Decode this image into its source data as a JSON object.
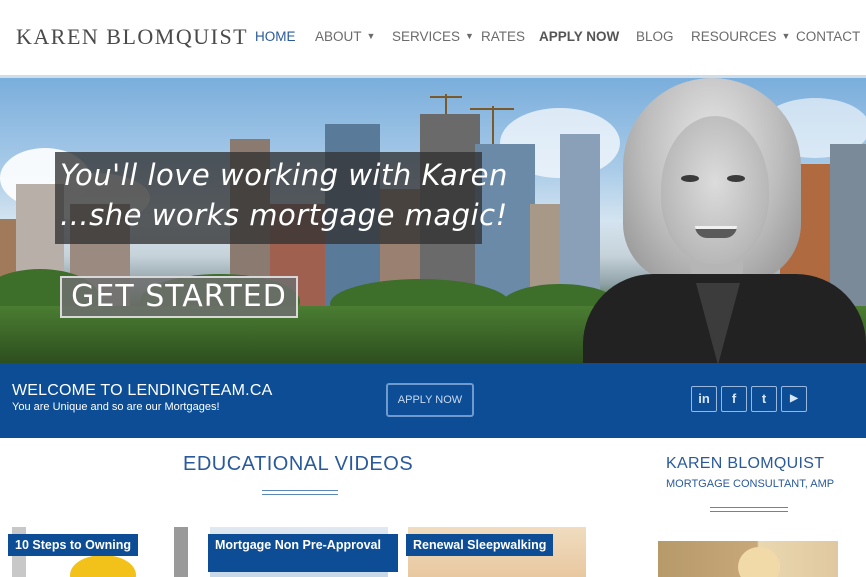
{
  "header": {
    "logo": "KAREN BLOMQUIST",
    "nav": [
      {
        "label": "HOME",
        "active": true,
        "dropdown": false
      },
      {
        "label": "ABOUT",
        "active": false,
        "dropdown": true
      },
      {
        "label": "SERVICES",
        "active": false,
        "dropdown": true
      },
      {
        "label": "RATES",
        "active": false,
        "dropdown": false
      },
      {
        "label": "APPLY NOW",
        "active": false,
        "dropdown": false,
        "bold": true
      },
      {
        "label": "BLOG",
        "active": false,
        "dropdown": false
      },
      {
        "label": "RESOURCES",
        "active": false,
        "dropdown": true
      },
      {
        "label": "CONTACT",
        "active": false,
        "dropdown": false
      }
    ]
  },
  "hero": {
    "tagline_line1": "You'll love working with Karen",
    "tagline_line2": "...she works mortgage magic!",
    "cta": "GET STARTED"
  },
  "welcome": {
    "title": "WELCOME TO LENDINGTEAM.CA",
    "subtitle": "You are Unique and so are our Mortgages!",
    "apply_button": "APPLY NOW",
    "social": [
      {
        "name": "linkedin-icon",
        "glyph": "in"
      },
      {
        "name": "facebook-icon",
        "glyph": "f"
      },
      {
        "name": "twitter-icon",
        "glyph": "t"
      },
      {
        "name": "youtube-icon",
        "glyph": "▶"
      }
    ]
  },
  "videos": {
    "heading": "EDUCATIONAL VIDEOS",
    "items": [
      {
        "label": "10 Steps to Owning"
      },
      {
        "label": "Mortgage Non Pre-Approval"
      },
      {
        "label": "Renewal Sleepwalking"
      }
    ]
  },
  "sidebar": {
    "name": "KAREN BLOMQUIST",
    "role": "MORTGAGE CONSULTANT, AMP"
  },
  "colors": {
    "brand_blue": "#0c4d96",
    "link_blue": "#2a5a9a"
  }
}
